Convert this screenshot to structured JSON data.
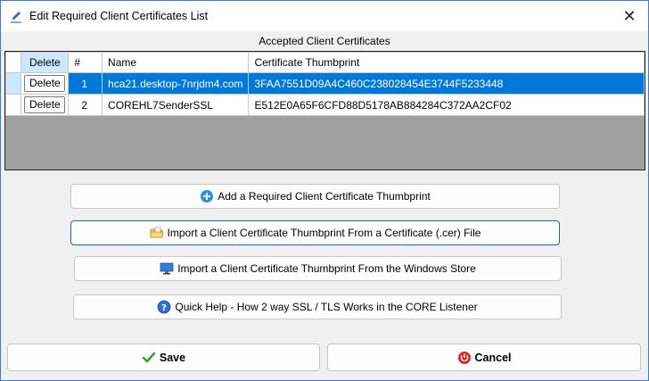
{
  "window": {
    "title": "Edit Required Client Certificates List",
    "close_symbol": "✕"
  },
  "grid": {
    "section_label": "Accepted Client Certificates",
    "columns": {
      "delete": "Delete",
      "num": "#",
      "name": "Name",
      "thumbprint": "Certificate Thumbprint"
    },
    "rows": [
      {
        "delete_label": "Delete",
        "num": "1",
        "name": "hca21.desktop-7nrjdm4.com",
        "thumbprint": "3FAA7551D09A4C460C238028454E3744F5233448"
      },
      {
        "delete_label": "Delete",
        "num": "2",
        "name": "COREHL7SenderSSL",
        "thumbprint": "E512E0A65F6CFD88D5178AB884284C372AA2CF02"
      }
    ]
  },
  "actions": {
    "add_label": "Add a Required Client Certificate Thumbprint",
    "import_file_label": "Import a Client Certificate Thumbprint From a Certificate (.cer) File",
    "import_store_label": "Import a Client Certificate Thumbprint From the Windows Store",
    "help_label": "Quick Help - How 2 way SSL / TLS Works in the CORE Listener"
  },
  "footer": {
    "save_label": "Save",
    "cancel_label": "Cancel"
  },
  "colors": {
    "selection": "#0078d7",
    "accent_border": "#1a64c6",
    "grid_empty": "#a0a0a0"
  }
}
